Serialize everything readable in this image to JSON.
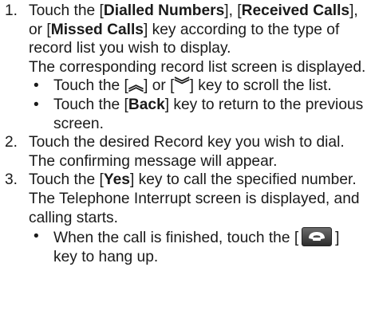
{
  "steps": [
    {
      "num": "1.",
      "p1": {
        "a": "Touch the [",
        "b1": "Dialled Numbers",
        "c": "], [",
        "b2": "Received Calls",
        "d": "], or [",
        "b3": "Missed Calls",
        "e": "] key according to the type of record list you wish to display."
      },
      "p2": "The corresponding record list screen is displayed.",
      "bullets": [
        {
          "pre": "Touch the [",
          "up": "︽",
          "mid": "] or [",
          "down": "︾",
          "post": "] key to scroll the list."
        },
        {
          "pre": "Touch the [",
          "bold": "Back",
          "post": "] key to return to the previous screen."
        }
      ]
    },
    {
      "num": "2.",
      "p1": "Touch the desired Record key you wish to dial.",
      "p2": "The confirming message will appear."
    },
    {
      "num": "3.",
      "p1": {
        "a": "Touch the [",
        "bold": "Yes",
        "post": "] key to call the specified number."
      },
      "p2": "The Telephone Interrupt screen is displayed, and calling starts.",
      "bullets": [
        {
          "pre": "When the call is finished, touch the [",
          "icon": "hang-up-icon",
          "post": "] key to hang up."
        }
      ]
    }
  ]
}
